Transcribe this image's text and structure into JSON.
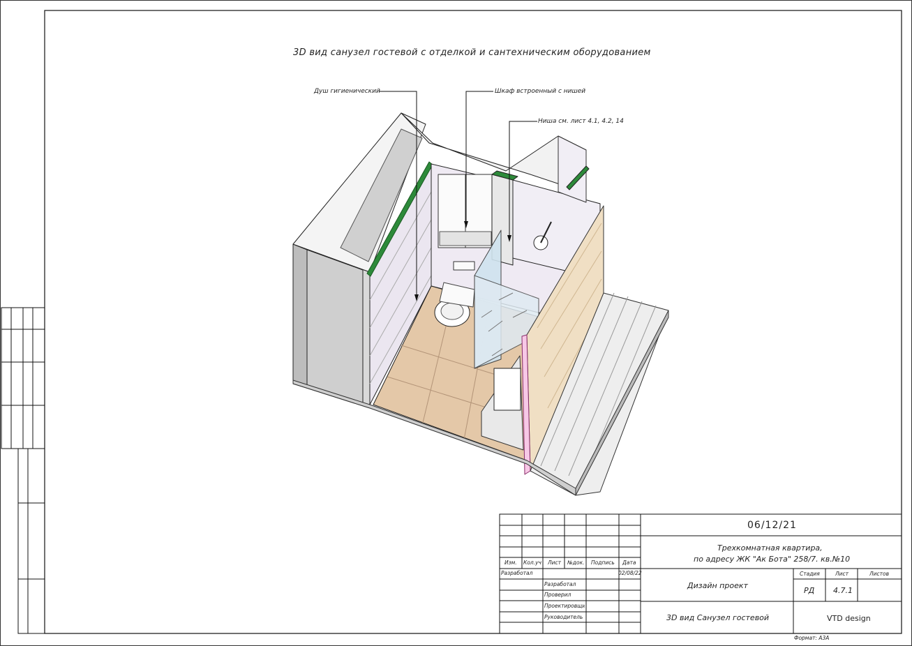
{
  "drawing": {
    "title": "3D вид санузел гостевой с отделкой и сантехническим оборудованием",
    "callouts": {
      "shower": "Душ гигиенический",
      "cabinet": "Шкаф встроенный с нишей",
      "niche": "Ниша см. лист 4.1, 4.2, 14"
    }
  },
  "stamp": {
    "date": "06/12/21",
    "project_line1": "Трехкомнатная квартира,",
    "project_line2": "по адресу ЖК \"Ак Бота\" 258/7. кв.№10",
    "col_headers": [
      "Изм.",
      "Кол.уч",
      "Лист",
      "№док.",
      "Подпись",
      "Дата"
    ],
    "developed_left": "Разработал",
    "sign_date": "02/08/22",
    "roles": [
      "Разработал",
      "Проверил",
      "Проектировщик",
      "Руководитель"
    ],
    "stage_type": "Дизайн проект",
    "stage_label": "Стадия",
    "sheet_label": "Лист",
    "sheets_label": "Листов",
    "stage_value": "РД",
    "sheet_value": "4.7.1",
    "sheet_name": "3D вид Санузел гостевой",
    "company": "VTD design",
    "format": "Формат: А3А"
  }
}
